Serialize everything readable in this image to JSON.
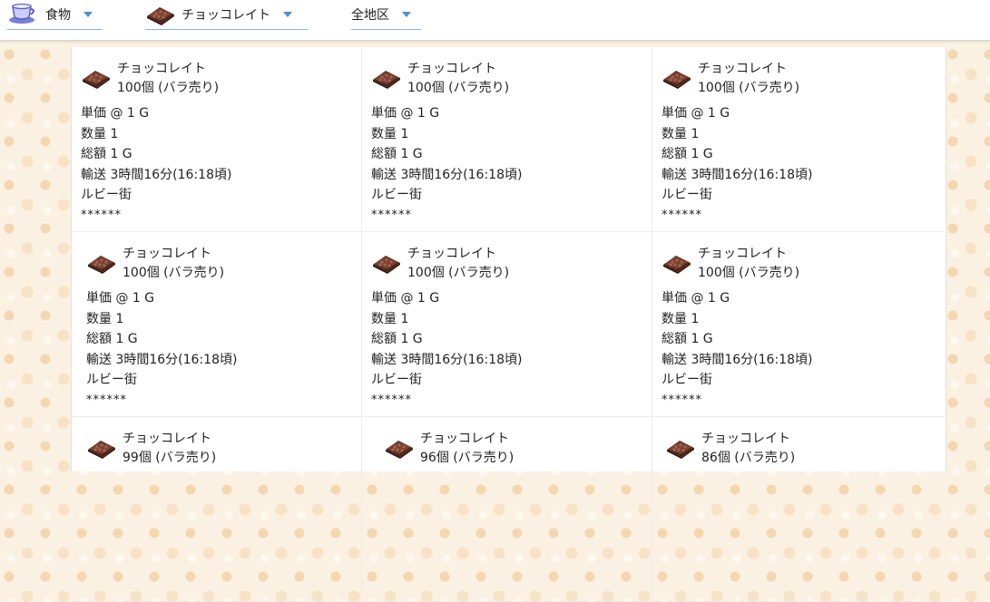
{
  "filters": {
    "category": "食物",
    "item": "チョッコレイト",
    "region": "全地区"
  },
  "listings": [
    {
      "name": "チョッコレイト",
      "qty": "100個 (バラ売り)",
      "unit_price": "単価 @ 1 G",
      "count": "数量 1",
      "total": "総額 1 G",
      "transport": "輸送 3時間16分(16:18頃)",
      "town": "ルビー街",
      "rating": "******"
    },
    {
      "name": "チョッコレイト",
      "qty": "100個 (バラ売り)",
      "unit_price": "単価 @ 1 G",
      "count": "数量 1",
      "total": "総額 1 G",
      "transport": "輸送 3時間16分(16:18頃)",
      "town": "ルビー街",
      "rating": "******"
    },
    {
      "name": "チョッコレイト",
      "qty": "100個 (バラ売り)",
      "unit_price": "単価 @ 1 G",
      "count": "数量 1",
      "total": "総額 1 G",
      "transport": "輸送 3時間16分(16:18頃)",
      "town": "ルビー街",
      "rating": "******"
    },
    {
      "name": "チョッコレイト",
      "qty": "100個 (バラ売り)",
      "unit_price": "単価 @ 1 G",
      "count": "数量 1",
      "total": "総額 1 G",
      "transport": "輸送 3時間16分(16:18頃)",
      "town": "ルビー街",
      "rating": "******"
    },
    {
      "name": "チョッコレイト",
      "qty": "100個 (バラ売り)",
      "unit_price": "単価 @ 1 G",
      "count": "数量 1",
      "total": "総額 1 G",
      "transport": "輸送 3時間16分(16:18頃)",
      "town": "ルビー街",
      "rating": "******"
    },
    {
      "name": "チョッコレイト",
      "qty": "100個 (バラ売り)",
      "unit_price": "単価 @ 1 G",
      "count": "数量 1",
      "total": "総額 1 G",
      "transport": "輸送 3時間16分(16:18頃)",
      "town": "ルビー街",
      "rating": "******"
    },
    {
      "name": "チョッコレイト",
      "qty": "99個 (バラ売り)"
    },
    {
      "name": "チョッコレイト",
      "qty": "96個 (バラ売り)"
    },
    {
      "name": "チョッコレイト",
      "qty": "86個 (バラ売り)"
    }
  ]
}
